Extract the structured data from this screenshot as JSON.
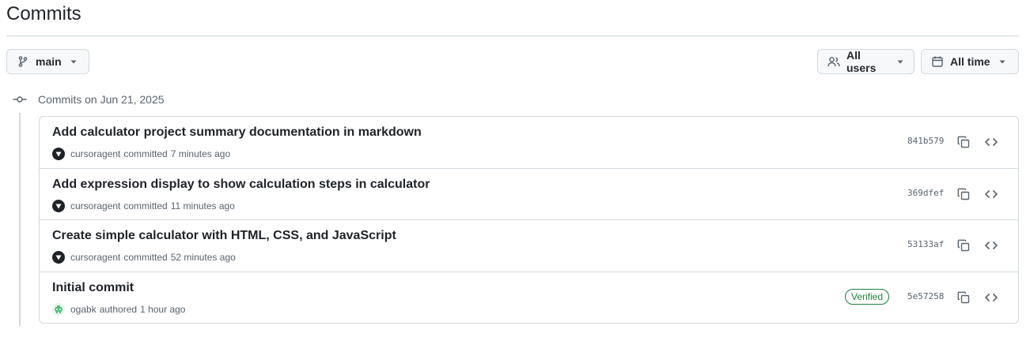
{
  "page": {
    "title": "Commits"
  },
  "filters": {
    "branch_label": "main",
    "users_label": "All users",
    "time_label": "All time"
  },
  "group": {
    "heading": "Commits on Jun 21, 2025"
  },
  "commits": [
    {
      "message": "Add calculator project summary documentation in markdown",
      "author": "cursoragent",
      "action": "committed",
      "time": "7 minutes ago",
      "sha": "841b579",
      "verified": ""
    },
    {
      "message": "Add expression display to show calculation steps in calculator",
      "author": "cursoragent",
      "action": "committed",
      "time": "11 minutes ago",
      "sha": "369dfef",
      "verified": ""
    },
    {
      "message": "Create simple calculator with HTML, CSS, and JavaScript",
      "author": "cursoragent",
      "action": "committed",
      "time": "52 minutes ago",
      "sha": "53133af",
      "verified": ""
    },
    {
      "message": "Initial commit",
      "author": "ogabk",
      "action": "authored",
      "time": "1 hour ago",
      "sha": "5e57258",
      "verified": "Verified"
    }
  ],
  "icons": {
    "branch": "git-branch-icon",
    "users": "people-icon",
    "time": "calendar-icon",
    "commit": "git-commit-icon",
    "copy": "copy-icon",
    "browse": "code-icon"
  },
  "colors": {
    "verified": "#1a7f37",
    "border": "#d1d9e0",
    "button_bg": "#f6f8fa"
  }
}
